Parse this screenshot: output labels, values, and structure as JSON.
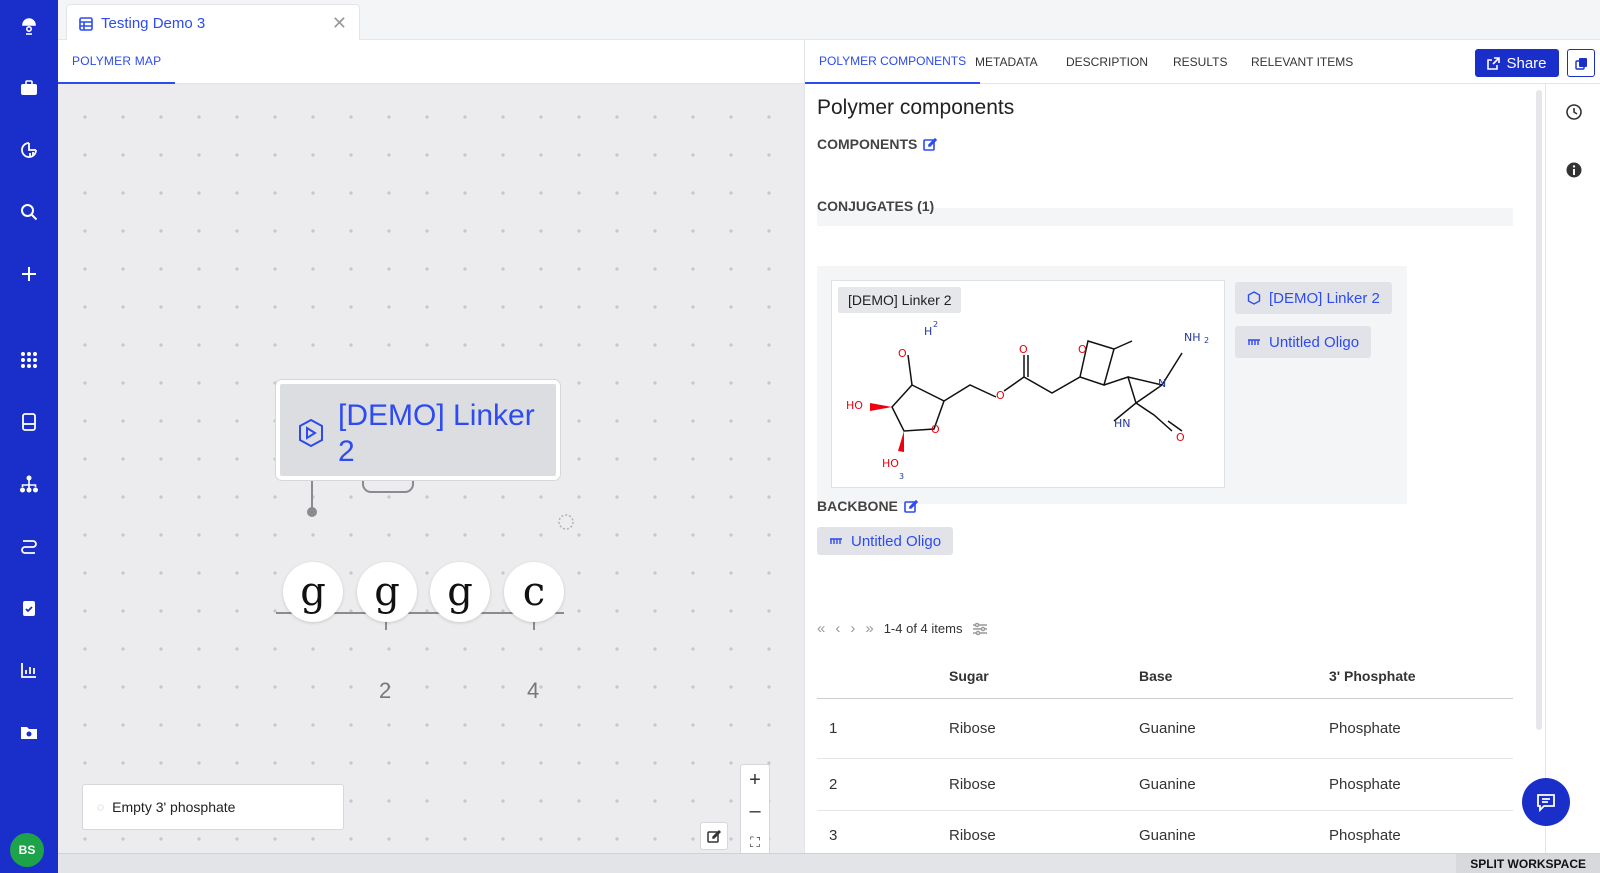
{
  "nav": {
    "icons": [
      "logo-icon",
      "briefcase-icon",
      "dashboard-icon",
      "search-icon",
      "plus-icon",
      "apps-icon",
      "notebook-icon",
      "hierarchy-icon",
      "workflow-icon",
      "clipboard-icon",
      "chart-icon",
      "folder-icon"
    ],
    "avatar_initials": "BS"
  },
  "doc_tab": {
    "title": "Testing Demo 3"
  },
  "left": {
    "tab_label": "POLYMER MAP",
    "node_label": "[DEMO] Linker 2",
    "beads": [
      "g",
      "g",
      "g",
      "c"
    ],
    "ruler_labels": [
      "2",
      "4"
    ],
    "empty_label": "Empty 3' phosphate",
    "zoom": {
      "in": "+",
      "out": "–",
      "fit": "⛶"
    }
  },
  "right": {
    "tabs": [
      "POLYMER COMPONENTS",
      "METADATA",
      "DESCRIPTION",
      "RESULTS",
      "RELEVANT ITEMS"
    ],
    "share_label": "Share",
    "title": "Polymer components",
    "components_label": "COMPONENTS",
    "conjugates_label": "CONJUGATES (1)",
    "molecule_tag": "[DEMO] Linker 2",
    "conj_chips": [
      "[DEMO] Linker 2",
      "Untitled Oligo"
    ],
    "backbone_label": "BACKBONE",
    "backbone_chip": "Untitled Oligo",
    "pager_text": "1-4 of 4 items",
    "table": {
      "headers": [
        "",
        "Sugar",
        "Base",
        "3' Phosphate"
      ],
      "rows": [
        [
          "1",
          "Ribose",
          "Guanine",
          "Phosphate"
        ],
        [
          "2",
          "Ribose",
          "Guanine",
          "Phosphate"
        ],
        [
          "3",
          "Ribose",
          "Guanine",
          "Phosphate"
        ]
      ]
    }
  },
  "footer": {
    "split_label": "SPLIT WORKSPACE"
  },
  "colors": {
    "rail": "#1a2fc9",
    "accent": "#2d4bf0"
  }
}
